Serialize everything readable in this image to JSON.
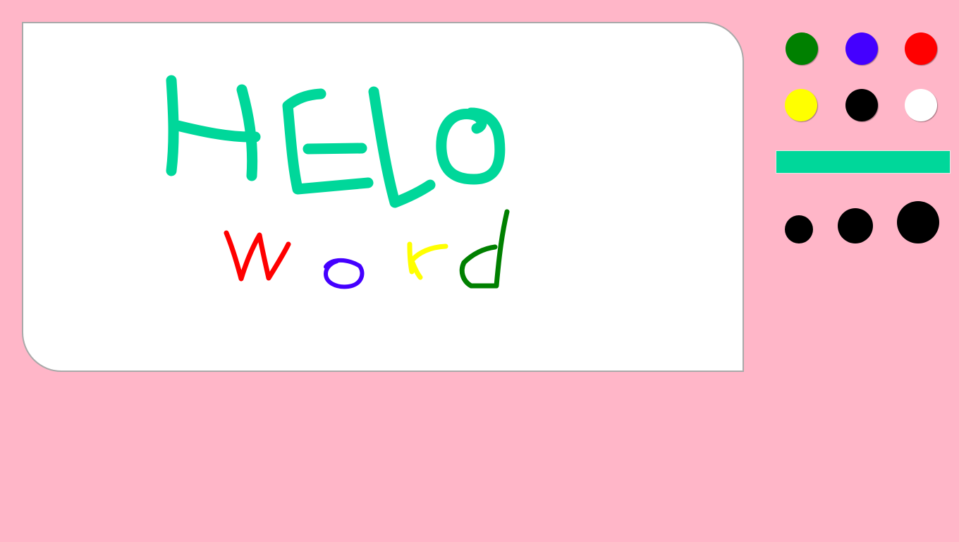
{
  "app": {
    "background_color": "#ffb6c8"
  },
  "canvas": {
    "background_color": "#ffffff",
    "border_color": "#a9a9a9",
    "drawing": {
      "word_1": {
        "text": "HELO",
        "color": "#00d79a"
      },
      "word_2": {
        "text": "word",
        "letters": [
          {
            "char": "w",
            "color": "#ff0000"
          },
          {
            "char": "o",
            "color": "#4400ff"
          },
          {
            "char": "r",
            "color": "#ffff00"
          },
          {
            "char": "d",
            "color": "#008000"
          }
        ]
      }
    }
  },
  "palette": {
    "colors": [
      {
        "name": "green",
        "hex": "#008000"
      },
      {
        "name": "blue",
        "hex": "#4400ff"
      },
      {
        "name": "red",
        "hex": "#ff0000"
      },
      {
        "name": "yellow",
        "hex": "#ffff00"
      },
      {
        "name": "black",
        "hex": "#000000"
      },
      {
        "name": "white",
        "hex": "#ffffff"
      }
    ],
    "selected_color": "#00d79a"
  },
  "brush_sizes": {
    "options": [
      "small",
      "medium",
      "large"
    ],
    "color": "#000000"
  }
}
